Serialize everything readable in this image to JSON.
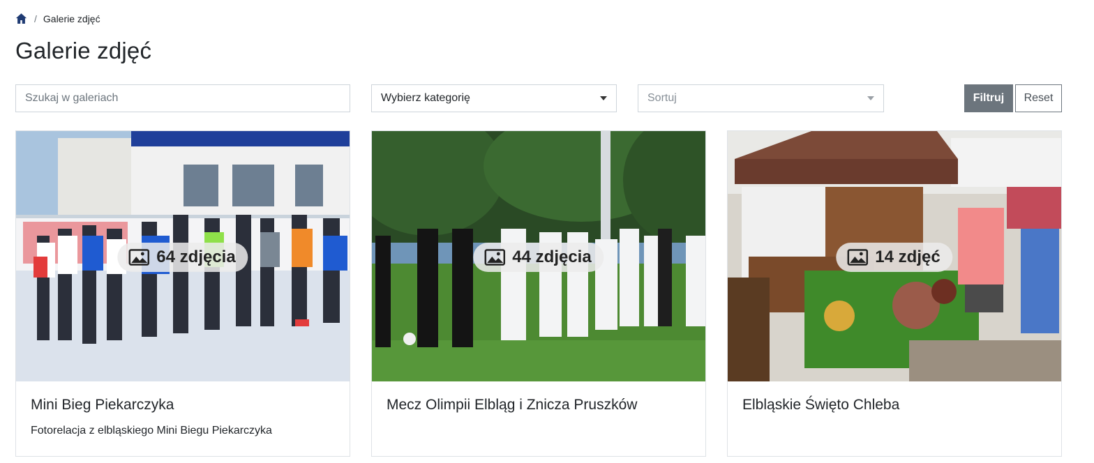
{
  "breadcrumb": {
    "home_icon": "home-icon",
    "current": "Galerie zdjęć"
  },
  "page": {
    "title": "Galerie zdjęć"
  },
  "filters": {
    "search_placeholder": "Szukaj w galeriach",
    "category_value": "Wybierz kategorię",
    "sort_placeholder": "Sortuj",
    "filter_label": "Filtruj",
    "reset_label": "Reset"
  },
  "galleries": [
    {
      "title": "Mini Bieg Piekarczyka",
      "description": "Fotorelacja z elbląskiego Mini Biegu Piekarczyka",
      "photo_count": "64 zdjęcia",
      "count_icon": "image-icon"
    },
    {
      "title": "Mecz Olimpii Elbląg i Znicza Pruszków",
      "description": "",
      "photo_count": "44 zdjęcia",
      "count_icon": "image-icon"
    },
    {
      "title": "Elbląskie Święto Chleba",
      "description": "",
      "photo_count": "14 zdjęć",
      "count_icon": "image-icon"
    }
  ],
  "colors": {
    "accent": "#6c757d",
    "home_icon": "#1f3b73",
    "border": "#ced4da"
  }
}
